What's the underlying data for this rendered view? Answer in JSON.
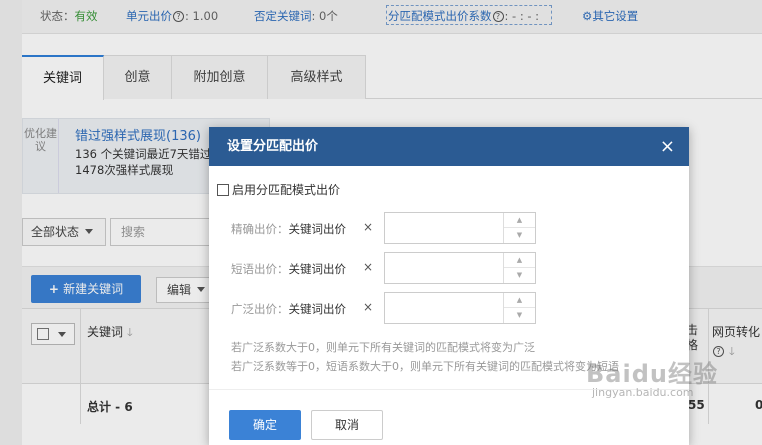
{
  "topbar": {
    "status_label": "状态：",
    "status_value": "有效",
    "unit_bid_label": "单元出价",
    "unit_bid_value": ": 1.00",
    "negative_kw_label": "否定关键词",
    "negative_kw_value": ": 0个",
    "match_coef_label": "分匹配模式出价系数",
    "match_coef_value": ": - : - :",
    "other_settings": "其它设置"
  },
  "tabs": [
    "关键词",
    "创意",
    "附加创意",
    "高级样式"
  ],
  "suggestion": {
    "side": "优化建议",
    "title": "错过强样式展现(136)",
    "line1": "136 个关键词最近7天错过",
    "line2": "1478次强样式展现"
  },
  "filter": {
    "status": "全部状态",
    "search_placeholder": "搜索"
  },
  "toolbar": {
    "new_keyword": "新建关键词",
    "edit": "编辑"
  },
  "table": {
    "col_keyword": "关键词",
    "col_click": "击格",
    "col_conversion": "网页转化",
    "total_label": "总计 - 6",
    "total_v1": "55",
    "total_v2": "0"
  },
  "modal": {
    "title": "设置分匹配出价",
    "close": "×",
    "enable_label": "启用分匹配模式出价",
    "rows": [
      {
        "label": "精确出价：",
        "ref": "关键词出价"
      },
      {
        "label": "短语出价：",
        "ref": "关键词出价"
      },
      {
        "label": "广泛出价：",
        "ref": "关键词出价"
      }
    ],
    "multiply": "×",
    "note1": "若广泛系数大于0，则单元下所有关键词的匹配模式将变为广泛",
    "note2": "若广泛系数等于0，短语系数大于0，则单元下所有关键词的匹配模式将变为短语",
    "ok": "确定",
    "cancel": "取消"
  },
  "watermark": {
    "brand": "Baidu经验",
    "url": "jingyan.baidu.com"
  }
}
